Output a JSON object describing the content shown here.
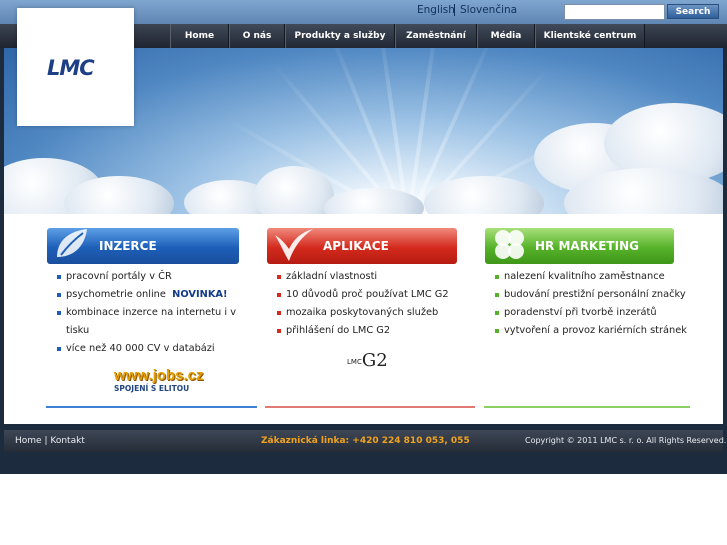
{
  "header": {
    "languages": [
      "English",
      "Slovenčina"
    ],
    "search": {
      "value": "",
      "button_label": "Search"
    }
  },
  "logo": {
    "text": "LMC"
  },
  "nav": {
    "items": [
      "Home",
      "O nás",
      "Produkty a služby",
      "Zaměstnání",
      "Média",
      "Klientské centrum"
    ]
  },
  "sections": {
    "inzerce": {
      "title": "INZERCE",
      "items": [
        "pracovní portály v ČR",
        "psychometrie online",
        "kombinace inzerce na internetu i v tisku",
        "více než 40 000 CV v databázi"
      ],
      "badge": "NOVINKA!",
      "logo_text": "www.jobs.cz",
      "logo_sub": "SPOJENÍ S ELITOU"
    },
    "aplikace": {
      "title": "APLIKACE",
      "items": [
        "základní vlastnosti",
        "10 důvodů proč používat LMC G2",
        "mozaika poskytovaných služeb",
        "přihlášení do LMC G2"
      ],
      "logo_small": "LMC",
      "logo_text": "G2"
    },
    "hr_marketing": {
      "title": "HR MARKETING",
      "items": [
        "nalezení kvalitního zaměstnance",
        "budování prestižní personální značky",
        "poradenství při tvorbě inzerátů",
        "vytvoření a provoz kariérních stránek"
      ]
    }
  },
  "footer": {
    "home": "Home",
    "separator": "|",
    "contact": "Kontakt",
    "hotline": "Zákaznická linka: +420 224 810 053, 055",
    "copyright": "Copyright © 2011 LMC s. r. o. All Rights Reserved."
  },
  "colors": {
    "inzerce": "#1d5fb8",
    "aplikace": "#d32a1d",
    "hr_marketing": "#56b22a",
    "hotline": "#f0a31c"
  }
}
